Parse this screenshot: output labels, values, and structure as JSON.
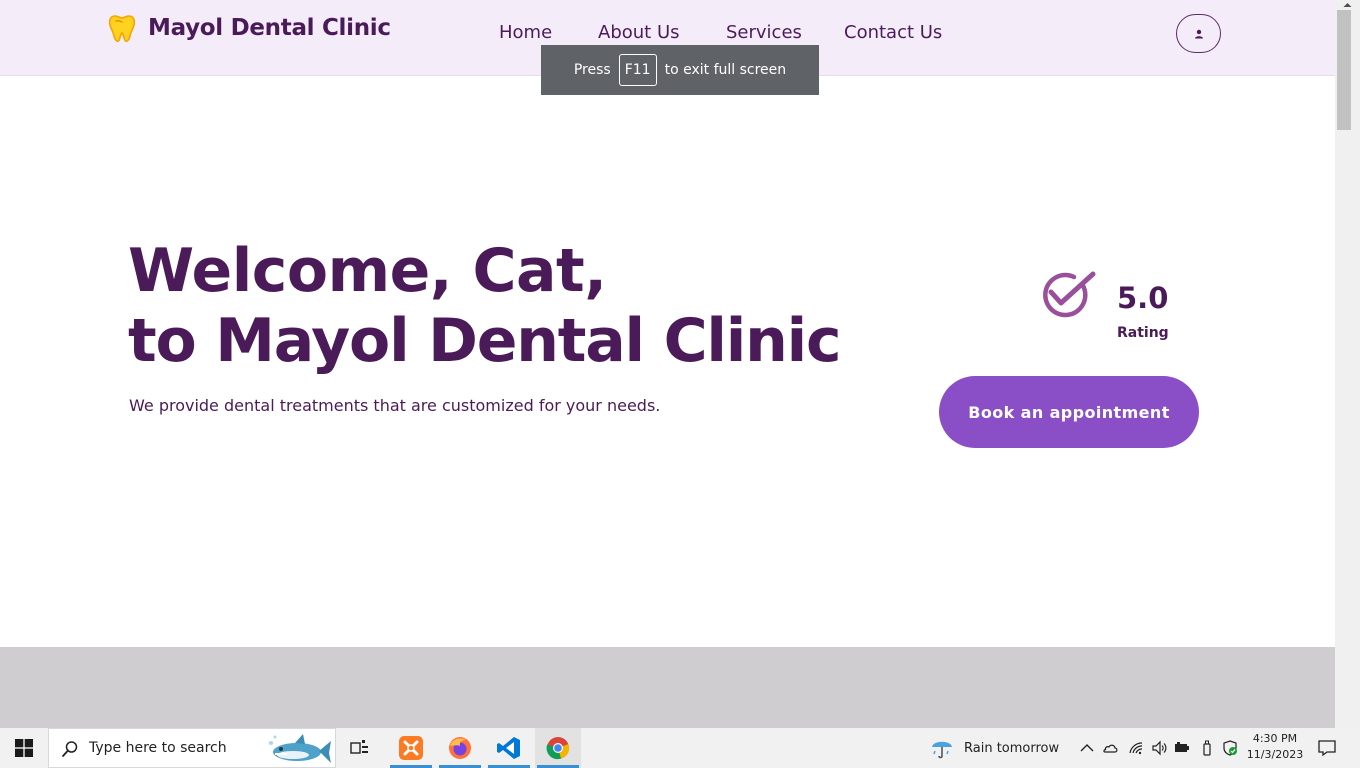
{
  "app": {
    "logo_text": "Mayol Dental Clinic"
  },
  "nav": {
    "items": [
      "Home",
      "About Us",
      "Services",
      "Contact Us"
    ]
  },
  "fullscreen_toast": {
    "prefix": "Press",
    "key": "F11",
    "suffix": "to exit full screen"
  },
  "hero": {
    "title_line1": "Welcome, Cat,",
    "title_line2": "to Mayol Dental Clinic",
    "subtitle": "We provide dental treatments that are customized for your needs.",
    "rating_value": "5.0",
    "rating_label": "Rating",
    "cta_label": "Book an appointment"
  },
  "taskbar": {
    "search_placeholder": "Type here to search",
    "apps": [
      "task-view",
      "xampp",
      "firefox",
      "vscode",
      "chrome"
    ],
    "weather_text": "Rain tomorrow",
    "time": "4:30 PM",
    "date": "11/3/2023"
  },
  "colors": {
    "brand_purple": "#4b1b59",
    "accent_purple": "#8a4ec7",
    "header_bg": "#f4edf9",
    "check_icon": "#9a4f9c"
  }
}
